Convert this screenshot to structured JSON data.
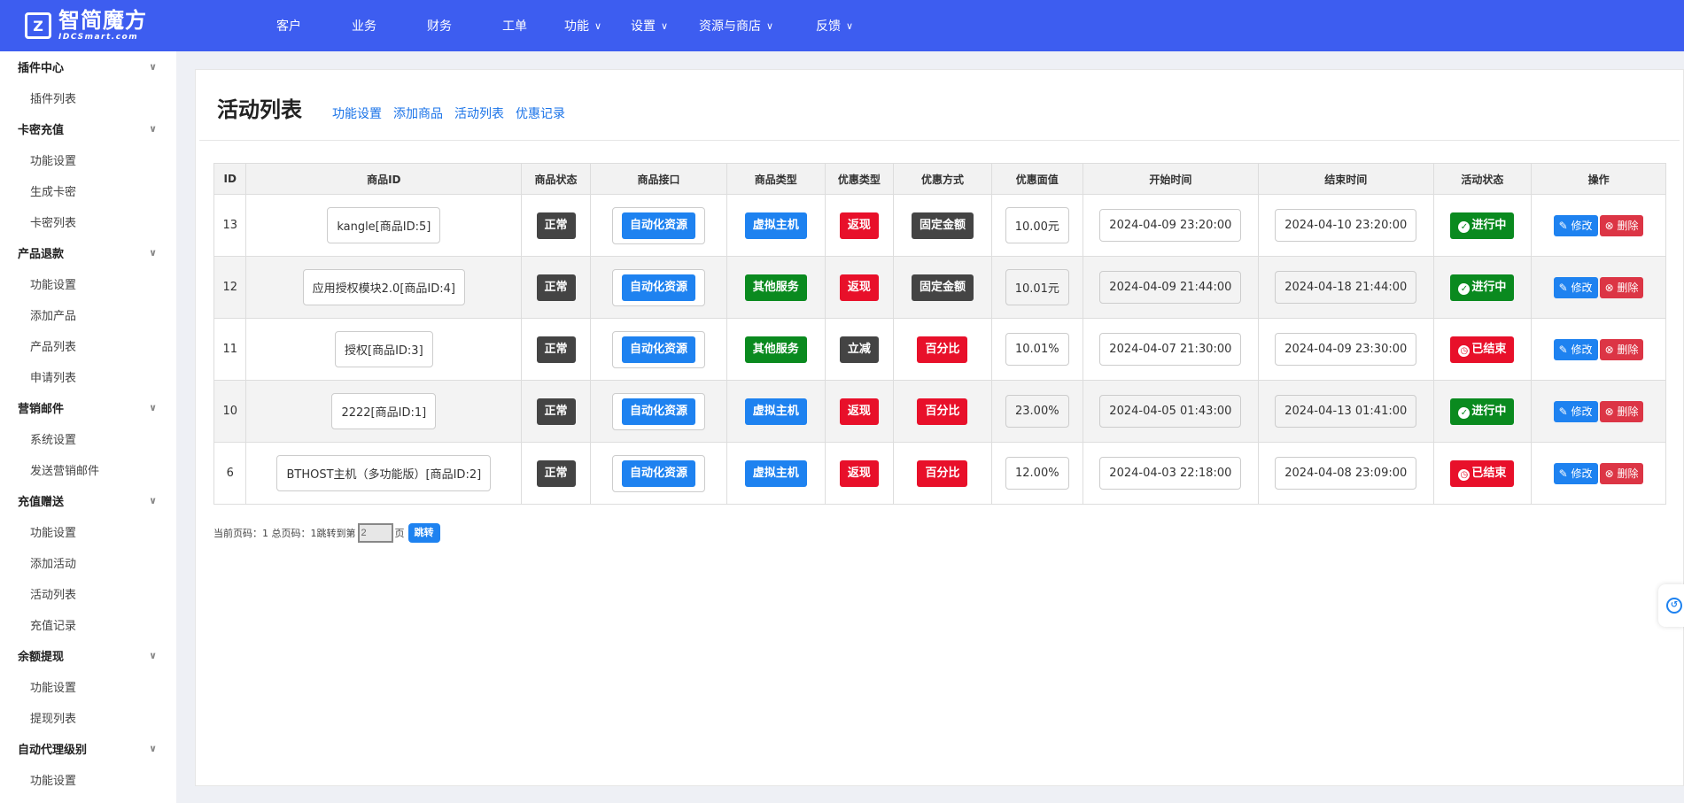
{
  "brand": {
    "name": "智简魔方",
    "sub": "IDCSmart.com",
    "mark": "Z"
  },
  "topnav": [
    {
      "label": "客户",
      "dropdown": false
    },
    {
      "label": "业务",
      "dropdown": false
    },
    {
      "label": "财务",
      "dropdown": false
    },
    {
      "label": "工单",
      "dropdown": false
    },
    {
      "label": "功能",
      "dropdown": true
    },
    {
      "label": "设置",
      "dropdown": true
    },
    {
      "label": "资源与商店",
      "dropdown": true
    },
    {
      "label": "反馈",
      "dropdown": true
    }
  ],
  "sidebar": [
    {
      "title": "插件中心",
      "items": [
        "插件列表"
      ]
    },
    {
      "title": "卡密充值",
      "items": [
        "功能设置",
        "生成卡密",
        "卡密列表"
      ]
    },
    {
      "title": "产品退款",
      "items": [
        "功能设置",
        "添加产品",
        "产品列表",
        "申请列表"
      ]
    },
    {
      "title": "营销邮件",
      "items": [
        "系统设置",
        "发送营销邮件"
      ]
    },
    {
      "title": "充值赠送",
      "items": [
        "功能设置",
        "添加活动",
        "活动列表",
        "充值记录"
      ]
    },
    {
      "title": "余额提现",
      "items": [
        "功能设置",
        "提现列表"
      ]
    },
    {
      "title": "自动代理级别",
      "items": [
        "功能设置"
      ]
    }
  ],
  "page": {
    "title": "活动列表",
    "links": [
      "功能设置",
      "添加商品",
      "活动列表",
      "优惠记录"
    ]
  },
  "table": {
    "headers": [
      "ID",
      "商品ID",
      "商品状态",
      "商品接口",
      "商品类型",
      "优惠类型",
      "优惠方式",
      "优惠面值",
      "开始时间",
      "结束时间",
      "活动状态",
      "操作"
    ],
    "rows": [
      {
        "id": "13",
        "product": "kangle[商品ID:5]",
        "status": "正常",
        "api": "自动化资源",
        "ptype": "虚拟主机",
        "ptype_color": "blue",
        "dtype": "返现",
        "dtype_color": "red",
        "dmode": "固定金额",
        "dmode_color": "dark",
        "value": "10.00元",
        "start": "2024-04-09 23:20:00",
        "end": "2024-04-10 23:20:00",
        "state": "进行中",
        "state_on": true
      },
      {
        "id": "12",
        "product": "应用授权模块2.0[商品ID:4]",
        "status": "正常",
        "api": "自动化资源",
        "ptype": "其他服务",
        "ptype_color": "green",
        "dtype": "返现",
        "dtype_color": "red",
        "dmode": "固定金额",
        "dmode_color": "dark",
        "value": "10.01元",
        "start": "2024-04-09 21:44:00",
        "end": "2024-04-18 21:44:00",
        "state": "进行中",
        "state_on": true
      },
      {
        "id": "11",
        "product": "授权[商品ID:3]",
        "status": "正常",
        "api": "自动化资源",
        "ptype": "其他服务",
        "ptype_color": "green",
        "dtype": "立减",
        "dtype_color": "dark",
        "dmode": "百分比",
        "dmode_color": "red",
        "value": "10.01%",
        "start": "2024-04-07 21:30:00",
        "end": "2024-04-09 23:30:00",
        "state": "已结束",
        "state_on": false
      },
      {
        "id": "10",
        "product": "2222[商品ID:1]",
        "status": "正常",
        "api": "自动化资源",
        "ptype": "虚拟主机",
        "ptype_color": "blue",
        "dtype": "返现",
        "dtype_color": "red",
        "dmode": "百分比",
        "dmode_color": "red",
        "value": "23.00%",
        "start": "2024-04-05 01:43:00",
        "end": "2024-04-13 01:41:00",
        "state": "进行中",
        "state_on": true
      },
      {
        "id": "6",
        "product": "BTHOST主机（多功能版）[商品ID:2]",
        "status": "正常",
        "api": "自动化资源",
        "ptype": "虚拟主机",
        "ptype_color": "blue",
        "dtype": "返现",
        "dtype_color": "red",
        "dmode": "百分比",
        "dmode_color": "red",
        "value": "12.00%",
        "start": "2024-04-03 22:18:00",
        "end": "2024-04-08 23:09:00",
        "state": "已结束",
        "state_on": false
      }
    ],
    "edit_label": "修改",
    "delete_label": "删除"
  },
  "pager": {
    "text": "当前页码：1 总页码：1",
    "jump_label": "跳转到第",
    "input_value": "2",
    "page_suffix": "页",
    "go_label": "跳转"
  },
  "colors": {
    "topbar": "#3d5df0",
    "link": "#1a73e8",
    "blue": "#1e82f0",
    "green": "#0a8a1f",
    "red": "#e8102a",
    "dark": "#444444"
  }
}
